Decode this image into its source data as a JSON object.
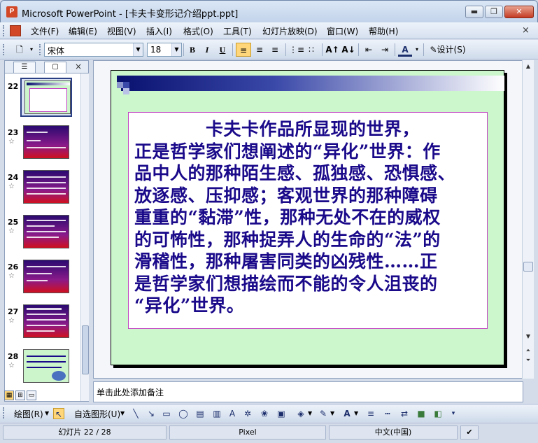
{
  "window": {
    "app_name": "Microsoft PowerPoint",
    "title": "Microsoft PowerPoint - [卡夫卡变形记介绍ppt.ppt]",
    "min_label": "▬",
    "max_label": "❐",
    "close_label": "✕"
  },
  "menu": {
    "items": [
      "文件(F)",
      "编辑(E)",
      "视图(V)",
      "插入(I)",
      "格式(O)",
      "工具(T)",
      "幻灯片放映(D)",
      "窗口(W)",
      "帮助(H)"
    ],
    "close_doc": "×"
  },
  "toolbar": {
    "font_name": "宋体",
    "font_size": "18",
    "bold": "B",
    "italic": "I",
    "underline": "U",
    "design_label": "设计(S)"
  },
  "slide_pane": {
    "tab_outline": "☰",
    "tab_slides": "▢",
    "close": "×",
    "slides": [
      {
        "number": "22",
        "star": ""
      },
      {
        "number": "23",
        "star": "☆"
      },
      {
        "number": "24",
        "star": "☆"
      },
      {
        "number": "25",
        "star": "☆"
      },
      {
        "number": "26",
        "star": "☆"
      },
      {
        "number": "27",
        "star": "☆"
      },
      {
        "number": "28",
        "star": "☆"
      }
    ]
  },
  "slide": {
    "lines": [
      "　　　　卡夫卡作品所显现的世界，",
      "正是哲学家们想阐述的“异化”世界：作",
      "品中人的那种陌生感、孤独感、恐惧感、",
      "放逐感、压抑感；客观世界的那种障碍",
      "重重的“黏滞”性，那种无处不在的威权",
      "的可怖性，那种捉弄人的生命的“法”的",
      "滑稽性，那种屠害同类的凶残性……正",
      "是哲学家们想描绘而不能的令人沮丧的",
      "“异化”世界。"
    ]
  },
  "notes": {
    "placeholder": "单击此处添加备注"
  },
  "drawing_toolbar": {
    "draw_label": "绘图(R)",
    "autoshapes_label": "自选图形(U)"
  },
  "status": {
    "slide_info": "幻灯片 22 / 28",
    "design": "Pixel",
    "language": "中文(中国)"
  },
  "colors": {
    "slide_background": "#ccf7cc",
    "slide_text": "#1a0a8a",
    "textbox_border": "#c040c0",
    "title_band": "#0a1270"
  }
}
